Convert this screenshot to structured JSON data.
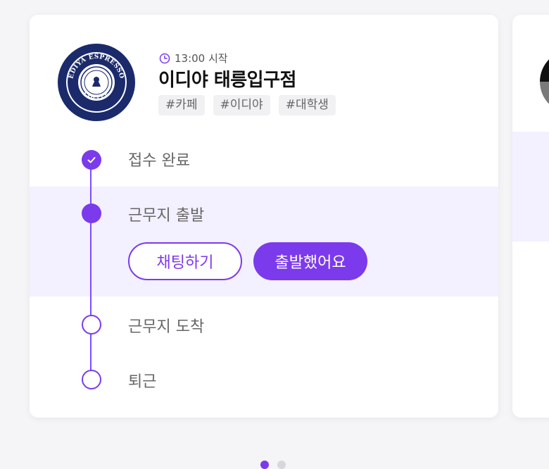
{
  "card": {
    "start_time": "13:00 시작",
    "store_name": "이디야 태릉입구점",
    "tags": [
      "#카페",
      "#이디야",
      "#대학생"
    ],
    "logo_text": {
      "top": "EDIYA ESPRESSO",
      "bottom": "COFFEE"
    }
  },
  "steps": [
    {
      "label": "접수 완료",
      "state": "done"
    },
    {
      "label": "근무지 출발",
      "state": "current"
    },
    {
      "label": "근무지 도착",
      "state": "todo"
    },
    {
      "label": "퇴근",
      "state": "todo"
    }
  ],
  "actions": {
    "chat_label": "채팅하기",
    "depart_label": "출발했어요"
  },
  "pager": {
    "count": 2,
    "active_index": 0
  },
  "colors": {
    "accent": "#7c3aed",
    "active_band": "#f3f0ff",
    "logo_bg": "#1b2a6b"
  },
  "icons": {
    "clock": "clock-icon",
    "check": "check-icon"
  }
}
